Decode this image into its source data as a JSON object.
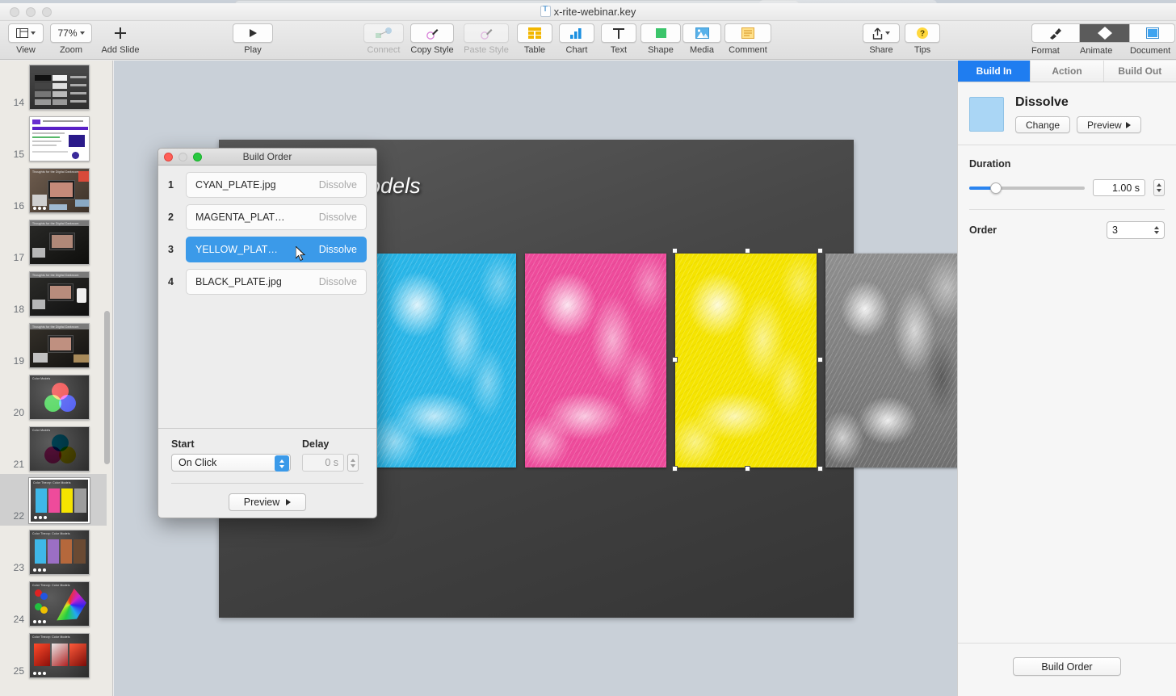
{
  "window": {
    "title": "x-rite-webinar.key",
    "doc_icon": "keynote-document-icon"
  },
  "toolbar": {
    "left": [
      {
        "label": "View",
        "icon": "view-layout-icon",
        "enabled": true
      },
      {
        "label": "Zoom",
        "icon": "zoom-percent",
        "value": "77%",
        "enabled": true
      },
      {
        "label": "Add Slide",
        "icon": "plus-icon",
        "enabled": true
      },
      {
        "label": "Play",
        "icon": "play-triangle-icon",
        "enabled": true
      }
    ],
    "center": [
      {
        "label": "Connect",
        "icon": "connect-icon",
        "enabled": false
      },
      {
        "label": "Copy Style",
        "icon": "eyedropper-icon",
        "enabled": true
      },
      {
        "label": "Paste Style",
        "icon": "eyedropper-icon",
        "enabled": false
      },
      {
        "label": "Table",
        "icon": "table-icon",
        "enabled": true
      },
      {
        "label": "Chart",
        "icon": "bar-chart-icon",
        "enabled": true
      },
      {
        "label": "Text",
        "icon": "text-t-icon",
        "enabled": true
      },
      {
        "label": "Shape",
        "icon": "shape-square-icon",
        "enabled": true
      },
      {
        "label": "Media",
        "icon": "media-photo-icon",
        "enabled": true
      },
      {
        "label": "Comment",
        "icon": "comment-note-icon",
        "enabled": true
      }
    ],
    "right": [
      {
        "label": "Share",
        "icon": "share-upload-icon",
        "enabled": true
      },
      {
        "label": "Tips",
        "icon": "question-mark-icon",
        "enabled": true
      }
    ],
    "inspector_toggles": [
      {
        "label": "Format",
        "icon": "format-brush-icon",
        "active": false
      },
      {
        "label": "Animate",
        "icon": "animate-diamond-icon",
        "active": true
      },
      {
        "label": "Document",
        "icon": "document-icon",
        "active": false
      }
    ]
  },
  "navigator": {
    "slides": [
      {
        "number": "14",
        "selected": false,
        "kind": "gray-swatch-chart",
        "title": "",
        "dots": 0
      },
      {
        "number": "15",
        "selected": false,
        "kind": "white-webpage",
        "title": "",
        "dots": 0
      },
      {
        "number": "16",
        "selected": false,
        "kind": "photo-desk-bright",
        "title": "Thoughts for the Digital Darkroom",
        "dots": 3
      },
      {
        "number": "17",
        "selected": false,
        "kind": "photo-desk-dark",
        "title": "Thoughts for the Digital Darkroom",
        "dots": 0
      },
      {
        "number": "18",
        "selected": false,
        "kind": "photo-desk-lamp",
        "title": "Thoughts for the Digital Darkroom",
        "dots": 0
      },
      {
        "number": "19",
        "selected": false,
        "kind": "photo-desk-warm",
        "title": "Thoughts for the Digital Darkroom",
        "dots": 0
      },
      {
        "number": "20",
        "selected": false,
        "kind": "rgb-venn",
        "title": "Color Models",
        "dots": 0
      },
      {
        "number": "21",
        "selected": false,
        "kind": "cmy-venn",
        "title": "Color Models",
        "dots": 0
      },
      {
        "number": "22",
        "selected": true,
        "kind": "cmyk-plates",
        "title": "Color Theory: Color Models",
        "dots": 3
      },
      {
        "number": "23",
        "selected": false,
        "kind": "color-strips",
        "title": "Color Theory: Color Models",
        "dots": 3
      },
      {
        "number": "24",
        "selected": false,
        "kind": "gamut-diagram",
        "title": "Color Theory: Color Models",
        "dots": 3
      },
      {
        "number": "25",
        "selected": false,
        "kind": "red-photos",
        "title": "Color Theory: Color Models",
        "dots": 3
      }
    ]
  },
  "canvas": {
    "slide_title": "ry: Colour Models",
    "plates": [
      {
        "name": "CYAN_PLATE",
        "color": "#29b6e8",
        "selected": false,
        "clipped": true
      },
      {
        "name": "MAGENTA_PLATE",
        "color": "#ee4b9b",
        "selected": false,
        "clipped": false
      },
      {
        "name": "YELLOW_PLATE",
        "color": "#f5e400",
        "selected": true,
        "clipped": false
      },
      {
        "name": "BLACK_PLATE",
        "color": "#9e9e9e",
        "selected": false,
        "clipped": false
      }
    ]
  },
  "inspector": {
    "tabs": [
      {
        "label": "Build In",
        "active": true
      },
      {
        "label": "Action",
        "active": false
      },
      {
        "label": "Build Out",
        "active": false
      }
    ],
    "effect": {
      "name": "Dissolve",
      "swatch_color": "#aad6f5",
      "change_label": "Change",
      "preview_label": "Preview"
    },
    "duration": {
      "label": "Duration",
      "value": "1.00 s",
      "slider_percent": 20
    },
    "order": {
      "label": "Order",
      "value": "3"
    },
    "footer_button": "Build Order"
  },
  "dialog": {
    "title": "Build Order",
    "rows": [
      {
        "index": "1",
        "name": "CYAN_PLATE.jpg",
        "effect": "Dissolve",
        "selected": false
      },
      {
        "index": "2",
        "name": "MAGENTA_PLAT…",
        "effect": "Dissolve",
        "selected": false
      },
      {
        "index": "3",
        "name": "YELLOW_PLAT…",
        "effect": "Dissolve",
        "selected": true
      },
      {
        "index": "4",
        "name": "BLACK_PLATE.jpg",
        "effect": "Dissolve",
        "selected": false
      }
    ],
    "start": {
      "label": "Start",
      "value": "On Click"
    },
    "delay": {
      "label": "Delay",
      "value": "0 s"
    },
    "preview_label": "Preview"
  },
  "colors": {
    "accent_blue": "#1f7df0",
    "selection_blue": "#3b9ae9",
    "workspace_bg": "#c9d0d8",
    "sidebar_bg": "#eceae5"
  }
}
